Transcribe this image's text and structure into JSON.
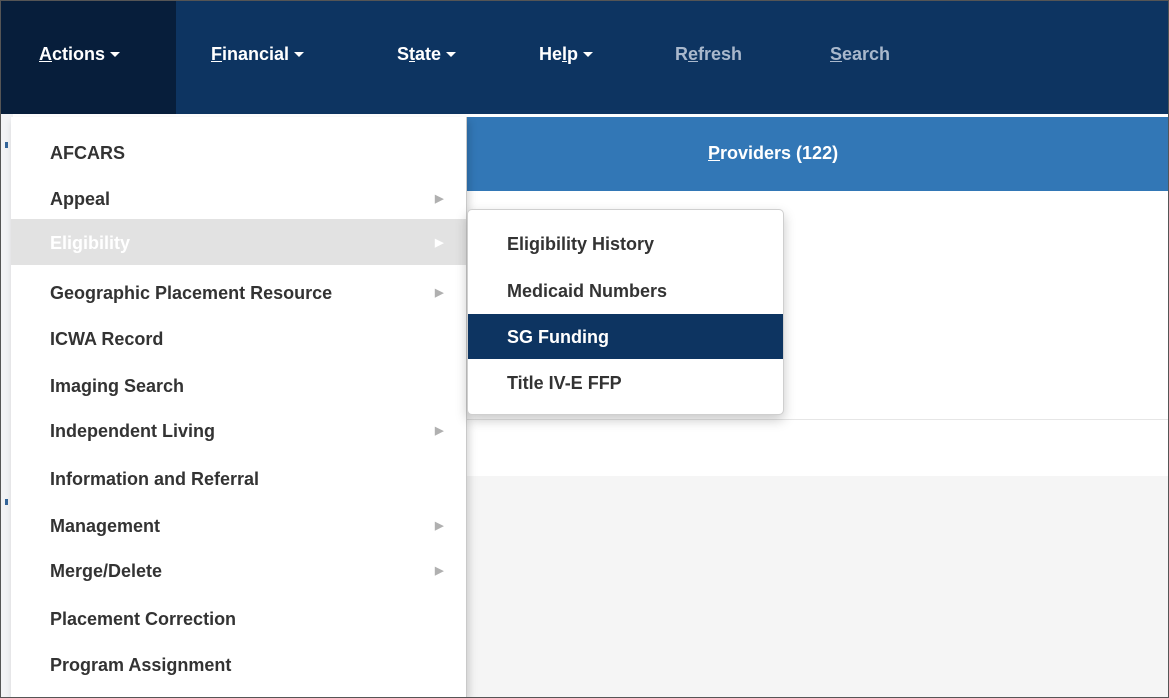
{
  "navbar": {
    "items": [
      {
        "pre": "",
        "key": "A",
        "post": "ctions",
        "dropdown": true
      },
      {
        "pre": "",
        "key": "F",
        "post": "inancial",
        "dropdown": true
      },
      {
        "pre": "S",
        "key": "t",
        "post": "ate",
        "dropdown": true
      },
      {
        "pre": "He",
        "key": "l",
        "post": "p",
        "dropdown": true
      },
      {
        "pre": "R",
        "key": "e",
        "post": "fresh",
        "dropdown": false
      },
      {
        "pre": "",
        "key": "S",
        "post": "earch",
        "dropdown": false
      }
    ]
  },
  "providers": {
    "key": "P",
    "rest": "roviders (122)"
  },
  "actions_menu": {
    "items": [
      {
        "label": "AFCARS",
        "submenu": false
      },
      {
        "label": "Appeal",
        "submenu": true
      },
      {
        "label": "Eligibility",
        "submenu": true
      },
      {
        "label": "Geographic Placement Resource",
        "submenu": true
      },
      {
        "label": "ICWA Record",
        "submenu": false
      },
      {
        "label": "Imaging Search",
        "submenu": false
      },
      {
        "label": "Independent Living",
        "submenu": true
      },
      {
        "label": "Information and Referral",
        "submenu": false
      },
      {
        "label": "Management",
        "submenu": true
      },
      {
        "label": "Merge/Delete",
        "submenu": true
      },
      {
        "label": "Placement Correction",
        "submenu": false
      },
      {
        "label": "Program Assignment",
        "submenu": false
      }
    ]
  },
  "eligibility_submenu": {
    "items": [
      {
        "label": "Eligibility History"
      },
      {
        "label": "Medicaid Numbers"
      },
      {
        "label": "SG Funding"
      },
      {
        "label": "Title IV-E FFP"
      }
    ]
  },
  "colors": {
    "navbar": "#0d3461",
    "navbar_active": "#071e3b",
    "providers_bar": "#3277b6",
    "menu_hover": "#e2e2e2",
    "submenu_selected": "#0d3461"
  }
}
